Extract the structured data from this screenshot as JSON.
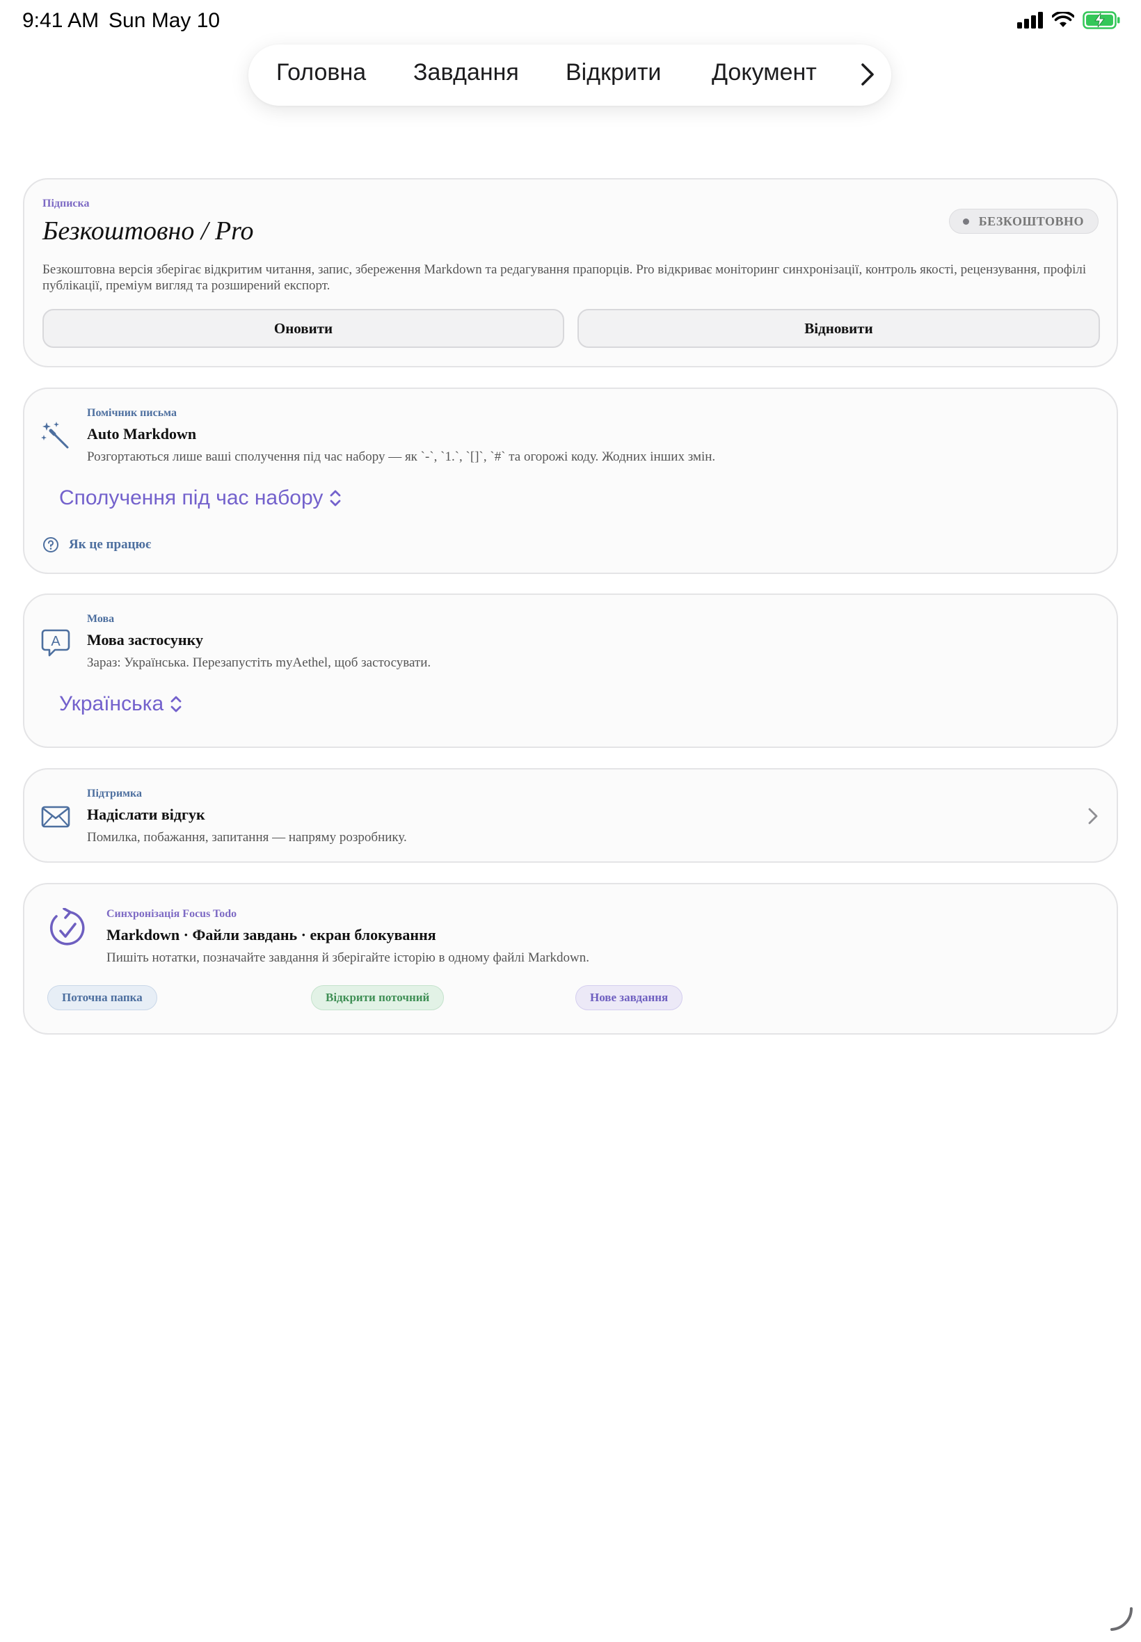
{
  "status_bar": {
    "time": "9:41 AM",
    "date": "Sun May 10"
  },
  "top_nav": {
    "tabs": [
      {
        "label": "Головна"
      },
      {
        "label": "Завдання"
      },
      {
        "label": "Відкрити"
      },
      {
        "label": "Документ"
      }
    ]
  },
  "subscription": {
    "eyebrow": "Підписка",
    "title": "Безкоштовно / Pro",
    "badge": "БЕЗКОШТОВНО",
    "description": "Безкоштовна версія зберігає відкритим читання, запис, збереження Markdown та редагування прапорців. Pro відкриває моніторинг синхронізації, контроль якості, рецензування, профілі публікації, преміум вигляд та розширений експорт.",
    "upgrade_label": "Оновити",
    "restore_label": "Відновити"
  },
  "writing_assistant": {
    "eyebrow": "Помічник письма",
    "title": "Auto Markdown",
    "description": "Розгортаються лише ваші сполучення під час набору — як `-`, `1.`, `[]`, `#` та огорожі коду. Жодних інших змін.",
    "picker_value": "Сполучення під час набору",
    "help_label": "Як це працює"
  },
  "language": {
    "eyebrow": "Мова",
    "title": "Мова застосунку",
    "description": "Зараз: Українська. Перезапустіть myAethel, щоб застосувати.",
    "picker_value": "Українська"
  },
  "support": {
    "eyebrow": "Підтримка",
    "title": "Надіслати відгук",
    "description": "Помилка, побажання, запитання — напряму розробнику."
  },
  "sync": {
    "eyebrow": "Синхронізація Focus Todo",
    "title": "Markdown · Файли завдань · екран блокування",
    "description": "Пишіть нотатки, позначайте завдання й зберігайте історію в одному файлі Markdown.",
    "pill_current_folder": "Поточна папка",
    "pill_open_current": "Відкрити поточний",
    "pill_new_task": "Нове завдання"
  },
  "colors": {
    "accent_purple": "#7361cc",
    "accent_blue": "#4d6f9f",
    "accent_green": "#3f8f55",
    "battery_green": "#34c759"
  }
}
